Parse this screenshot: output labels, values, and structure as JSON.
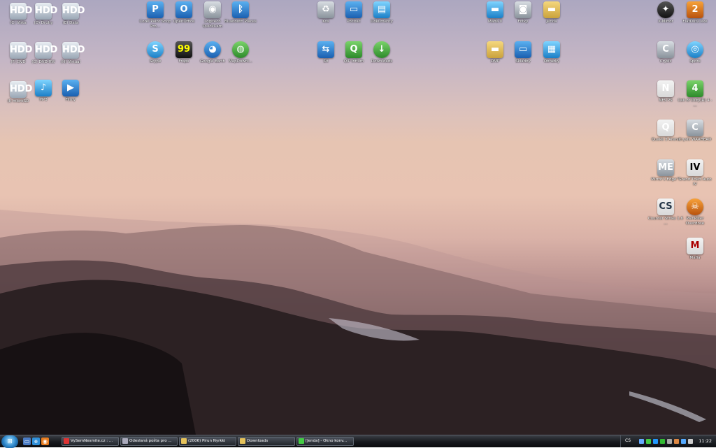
{
  "desktop_icons": {
    "d1": {
      "label": "(C) Vista",
      "glyph": "drive"
    },
    "d2": {
      "label": "(D) Druhy",
      "glyph": "drive"
    },
    "d3": {
      "label": "(E) Data",
      "glyph": "drive"
    },
    "d4": {
      "label": "(F) DVD",
      "glyph": "drive"
    },
    "d5": {
      "label": "(G) DVD-RW",
      "glyph": "drive"
    },
    "d6": {
      "label": "(H) Virtual",
      "glyph": "drive"
    },
    "d7": {
      "label": "(I) microSD",
      "glyph": "drive"
    },
    "d8": {
      "label": "MP3",
      "glyph": "music"
    },
    "d9": {
      "label": "Filmy",
      "glyph": "film"
    },
    "a1": {
      "label": "Corel Paint Shop Pro...",
      "glyph": "corel"
    },
    "a2": {
      "label": "OpenOffice",
      "glyph": "office"
    },
    "a3": {
      "label": "Logitech QuickCam",
      "glyph": "camera"
    },
    "a4": {
      "label": "Bluetooth Places",
      "glyph": "bluetooth"
    },
    "a5": {
      "label": "Skype",
      "glyph": "skype"
    },
    "a6": {
      "label": "Fraps",
      "glyph": "fraps"
    },
    "a7": {
      "label": "Google Earth",
      "glyph": "earth"
    },
    "a8": {
      "label": "MapDownl...",
      "glyph": "globe"
    },
    "b1": {
      "label": "Koš",
      "glyph": "recycle"
    },
    "b2": {
      "label": "Počítač",
      "glyph": "computer"
    },
    "b3": {
      "label": "Dokumenty",
      "glyph": "documents"
    },
    "b4": {
      "label": "Síť",
      "glyph": "network"
    },
    "b5": {
      "label": "QIP Infium",
      "glyph": "qip"
    },
    "b6": {
      "label": "Downloads",
      "glyph": "downloads"
    },
    "c1": {
      "label": "Mafia II",
      "glyph": "folder"
    },
    "c2": {
      "label": "Fotky",
      "glyph": "photos"
    },
    "c3": {
      "label": "Jenda",
      "glyph": "folder"
    },
    "c4": {
      "label": "DMP",
      "glyph": "folder"
    },
    "c5": {
      "label": "Skladby",
      "glyph": "monitor"
    },
    "c6": {
      "label": "Obrázky",
      "glyph": "pictures"
    },
    "g1": {
      "label": "X-Mirror",
      "glyph": "game"
    },
    "g2": {
      "label": "FlatOut2.exe",
      "glyph": "flatout"
    },
    "g3": {
      "label": "Crysis",
      "glyph": "crysis"
    },
    "g4": {
      "label": "Spore",
      "glyph": "spore"
    },
    "g5": {
      "label": "NFS PS",
      "glyph": "nfs"
    },
    "g6": {
      "label": "Call of Duty(R) 4 - ...",
      "glyph": "cod"
    },
    "g7": {
      "label": "Quake 3 Arena",
      "glyph": "quake"
    },
    "g8": {
      "label": "Crysis WARHEAD",
      "glyph": "crysis"
    },
    "g9": {
      "label": "Mirror's Edge™",
      "glyph": "mirror"
    },
    "g10": {
      "label": "Grand Theft Auto IV",
      "glyph": "gta"
    },
    "g11": {
      "label": "Counter Strike 1.6 ...",
      "glyph": "cs"
    },
    "g12": {
      "label": "Painkiller Overdose",
      "glyph": "painkiller"
    },
    "g13": {
      "label": "Mafia",
      "glyph": "mafia"
    }
  },
  "glyph_chars": {
    "drive": "HDD",
    "music": "♪",
    "film": "▶",
    "corel": "P",
    "office": "O",
    "camera": "◉",
    "bluetooth": "ᛒ",
    "skype": "S",
    "fraps": "99",
    "earth": "◕",
    "globe": "◍",
    "recycle": "♻",
    "computer": "▭",
    "documents": "▤",
    "network": "⇆",
    "qip": "Q",
    "downloads": "↓",
    "folder": "▬",
    "photos": "◙",
    "monitor": "▭",
    "pictures": "▦",
    "game": "✦",
    "flatout": "2",
    "crysis": "C",
    "spore": "◎",
    "nfs": "N",
    "cod": "4",
    "quake": "Q",
    "mirror": "ME",
    "gta": "IV",
    "cs": "CS",
    "painkiller": "☠",
    "mafia": "M"
  },
  "taskbar": {
    "start_label": "⊞",
    "quick_launch": [
      {
        "icon": "desktop-icon"
      },
      {
        "icon": "ie-icon"
      },
      {
        "icon": "firefox-icon"
      }
    ],
    "tasks": [
      {
        "label": "VySemNesmite.cz : ..."
      },
      {
        "label": "Odeslaná pošta pro ..."
      },
      {
        "label": "(2006) Pirun Nyrkki"
      },
      {
        "label": "Downloads"
      },
      {
        "label": "[Jenda] - Okno konv..."
      }
    ],
    "tray": {
      "language": "CS",
      "clock": "11:22"
    }
  },
  "colors": {
    "accent": "#2b84c8",
    "taskbar": "#16181c"
  }
}
